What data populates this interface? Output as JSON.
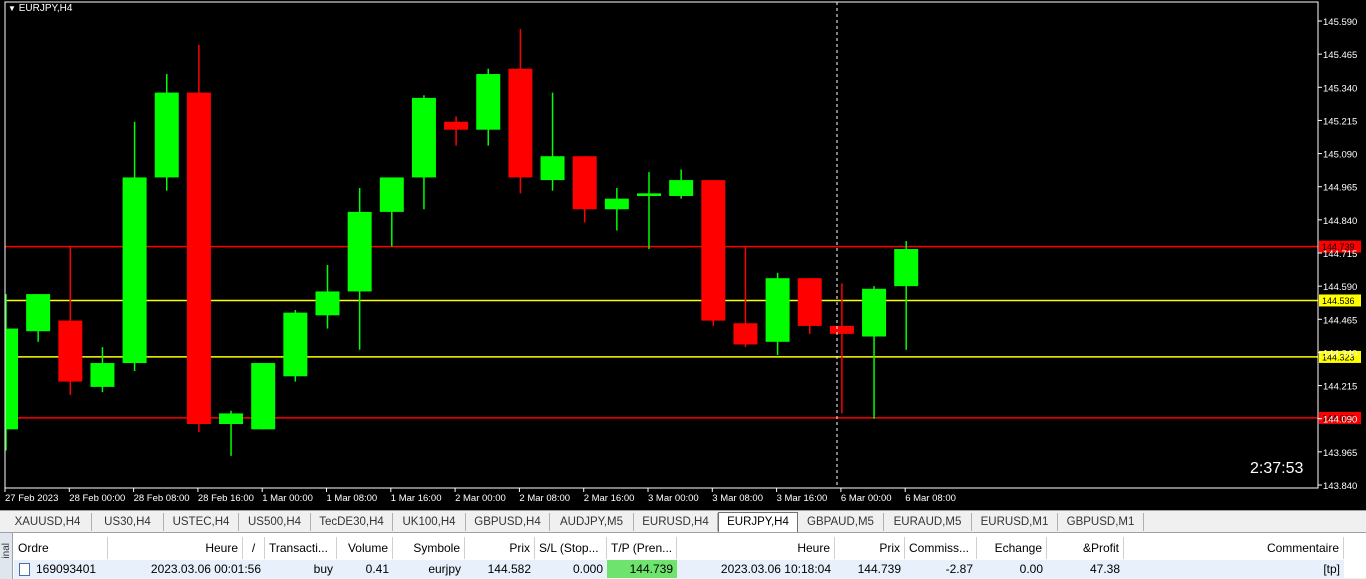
{
  "chart": {
    "symbol_label": "EURJPY,H4",
    "countdown": "2:37:53",
    "price_min": 143.84,
    "price_max": 145.59,
    "price_ticks": [
      "145.590",
      "145.465",
      "145.340",
      "145.215",
      "145.090",
      "144.965",
      "144.840",
      "144.715",
      "144.590",
      "144.465",
      "144.340",
      "144.215",
      "144.090",
      "143.965",
      "143.840"
    ],
    "time_labels": [
      "27 Feb 2023",
      "28 Feb 00:00",
      "28 Feb 08:00",
      "28 Feb 16:00",
      "1 Mar 00:00",
      "1 Mar 08:00",
      "1 Mar 16:00",
      "2 Mar 00:00",
      "2 Mar 08:00",
      "2 Mar 16:00",
      "3 Mar 00:00",
      "3 Mar 08:00",
      "3 Mar 16:00",
      "6 Mar 00:00",
      "6 Mar 08:00"
    ],
    "levels": [
      {
        "price": 144.739,
        "label": "144.739",
        "color": "#ff0000",
        "label_bg": "#ff0000",
        "label_fg": "#000000"
      },
      {
        "price": 144.536,
        "label": "144.536",
        "color": "#ffff00",
        "label_bg": "#ffff00",
        "label_fg": "#000000"
      },
      {
        "price": 144.323,
        "label": "144.323",
        "color": "#ffff00",
        "label_bg": "#ffff00",
        "label_fg": "#000000"
      },
      {
        "price": 144.093,
        "label": "144.093",
        "color": "#ff0000",
        "label_bg": "#ff0000",
        "label_fg": "#000000"
      }
    ],
    "colors": {
      "bull": "#00ff00",
      "bear": "#ff0000",
      "background": "#000000",
      "axis_text": "#ffffff"
    },
    "candles": [
      {
        "o": 144.05,
        "h": 144.56,
        "l": 143.97,
        "c": 144.43
      },
      {
        "o": 144.42,
        "h": 144.56,
        "l": 144.38,
        "c": 144.56
      },
      {
        "o": 144.46,
        "h": 144.74,
        "l": 144.18,
        "c": 144.23
      },
      {
        "o": 144.21,
        "h": 144.36,
        "l": 144.19,
        "c": 144.3
      },
      {
        "o": 144.3,
        "h": 145.21,
        "l": 144.27,
        "c": 145.0
      },
      {
        "o": 145.0,
        "h": 145.39,
        "l": 144.95,
        "c": 145.32
      },
      {
        "o": 145.32,
        "h": 145.5,
        "l": 144.04,
        "c": 144.07
      },
      {
        "o": 144.07,
        "h": 144.12,
        "l": 143.95,
        "c": 144.11
      },
      {
        "o": 144.05,
        "h": 144.3,
        "l": 144.05,
        "c": 144.3
      },
      {
        "o": 144.25,
        "h": 144.5,
        "l": 144.23,
        "c": 144.49
      },
      {
        "o": 144.48,
        "h": 144.67,
        "l": 144.43,
        "c": 144.57
      },
      {
        "o": 144.57,
        "h": 144.96,
        "l": 144.35,
        "c": 144.87
      },
      {
        "o": 144.87,
        "h": 144.99,
        "l": 144.74,
        "c": 145.0
      },
      {
        "o": 145.0,
        "h": 145.31,
        "l": 144.88,
        "c": 145.3
      },
      {
        "o": 145.21,
        "h": 145.23,
        "l": 145.12,
        "c": 145.18
      },
      {
        "o": 145.18,
        "h": 145.41,
        "l": 145.12,
        "c": 145.39
      },
      {
        "o": 145.41,
        "h": 145.56,
        "l": 144.94,
        "c": 145.0
      },
      {
        "o": 144.99,
        "h": 145.32,
        "l": 144.95,
        "c": 145.08
      },
      {
        "o": 145.08,
        "h": 145.08,
        "l": 144.83,
        "c": 144.88
      },
      {
        "o": 144.88,
        "h": 144.96,
        "l": 144.8,
        "c": 144.92
      },
      {
        "o": 144.93,
        "h": 145.02,
        "l": 144.73,
        "c": 144.94
      },
      {
        "o": 144.93,
        "h": 145.03,
        "l": 144.92,
        "c": 144.99
      },
      {
        "o": 144.99,
        "h": 144.99,
        "l": 144.44,
        "c": 144.46
      },
      {
        "o": 144.45,
        "h": 144.74,
        "l": 144.36,
        "c": 144.37
      },
      {
        "o": 144.38,
        "h": 144.64,
        "l": 144.33,
        "c": 144.62
      },
      {
        "o": 144.62,
        "h": 144.62,
        "l": 144.41,
        "c": 144.44
      },
      {
        "o": 144.44,
        "h": 144.6,
        "l": 144.11,
        "c": 144.41
      },
      {
        "o": 144.4,
        "h": 144.59,
        "l": 144.09,
        "c": 144.58
      },
      {
        "o": 144.59,
        "h": 144.76,
        "l": 144.35,
        "c": 144.73
      }
    ]
  },
  "tabs": [
    "XAUUSD,H4",
    "US30,H4",
    "USTEC,H4",
    "US500,H4",
    "TecDE30,H4",
    "UK100,H4",
    "GBPUSD,H4",
    "AUDJPY,M5",
    "EURUSD,H4",
    "EURJPY,H4",
    "GBPAUD,M5",
    "EURAUD,M5",
    "EURUSD,M1",
    "GBPUSD,M1"
  ],
  "active_tab": "EURJPY,H4",
  "terminal": {
    "side_label": "inal",
    "headers": [
      "Ordre",
      "Heure",
      "/",
      "Transacti...",
      "Volume",
      "Symbole",
      "Prix",
      "S/L (Stop...",
      "T/P (Pren...",
      "Heure",
      "Prix",
      "Commiss...",
      "Echange",
      "&Profit",
      "Commentaire"
    ],
    "row": {
      "order": "169093401",
      "open_time": "2023.03.06 00:01:56",
      "type": "buy",
      "volume": "0.41",
      "symbol": "eurjpy",
      "price": "144.582",
      "sl": "0.000",
      "tp": "144.739",
      "close_time": "2023.03.06 10:18:04",
      "current_price": "144.739",
      "commission": "-2.87",
      "swap": "0.00",
      "profit": "47.38",
      "comment": "[tp]"
    }
  }
}
